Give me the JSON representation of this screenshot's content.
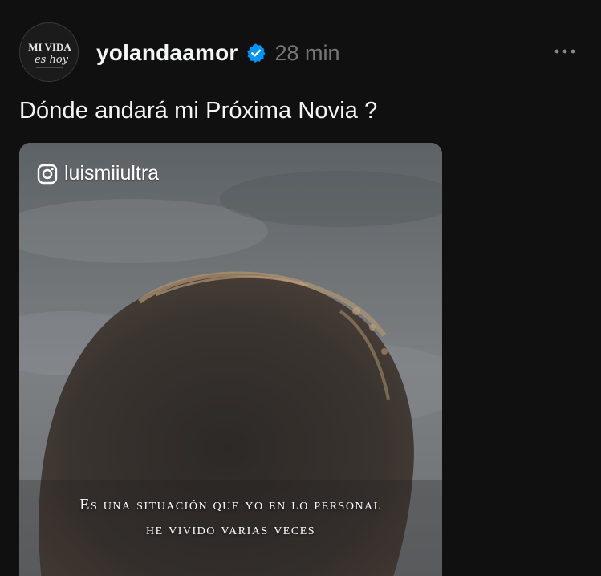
{
  "post": {
    "avatar": {
      "line1": "MI VIDA",
      "line2": "es hoy"
    },
    "username": "yolandaamor",
    "verified": true,
    "timestamp": "28 min",
    "more_icon": "more-horizontal-icon",
    "caption": "Dónde andará mi Próxima Novia ?",
    "media": {
      "instagram_handle": "luismiiultra",
      "subtitle_line1": "Es una situación que yo en lo personal",
      "subtitle_line2": "he vivido varias veces"
    }
  },
  "colors": {
    "background": "#101010",
    "text": "#f3f5f7",
    "muted": "#777777",
    "verified_badge": "#0095f6"
  }
}
